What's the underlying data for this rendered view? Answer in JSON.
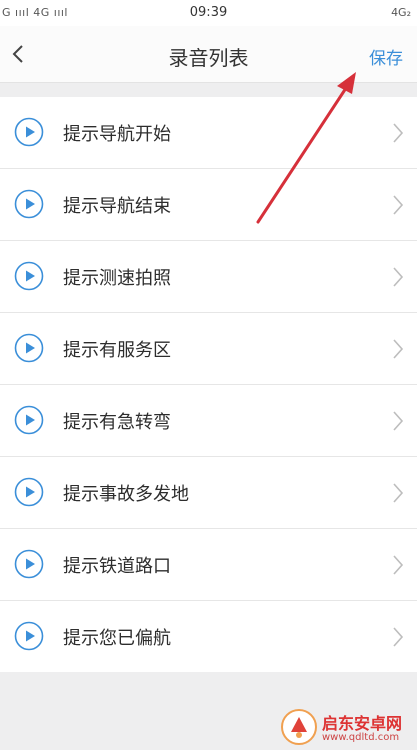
{
  "status": {
    "left": "G ıııl 4G ıııl",
    "time": "09:39",
    "right": "4G₂"
  },
  "nav": {
    "title": "录音列表",
    "save_label": "保存"
  },
  "items": [
    {
      "label": "提示导航开始"
    },
    {
      "label": "提示导航结束"
    },
    {
      "label": "提示测速拍照"
    },
    {
      "label": "提示有服务区"
    },
    {
      "label": "提示有急转弯"
    },
    {
      "label": "提示事故多发地"
    },
    {
      "label": "提示铁道路口"
    },
    {
      "label": "提示您已偏航"
    }
  ],
  "watermark": {
    "name": "启东安卓网",
    "url": "www.qdltd.com"
  },
  "colors": {
    "accent": "#3b8fd9",
    "annotation": "#d6303a"
  },
  "icons": {
    "back": "chevron-left-icon",
    "play": "play-circle-icon",
    "row_chevron": "chevron-right-icon"
  }
}
